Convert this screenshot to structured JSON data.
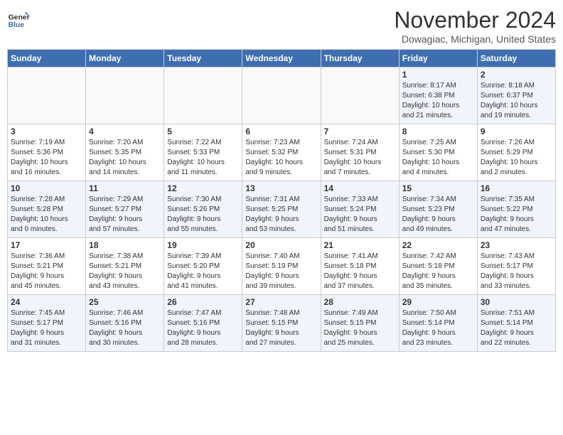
{
  "header": {
    "logo_line1": "General",
    "logo_line2": "Blue",
    "month": "November 2024",
    "location": "Dowagiac, Michigan, United States"
  },
  "weekdays": [
    "Sunday",
    "Monday",
    "Tuesday",
    "Wednesday",
    "Thursday",
    "Friday",
    "Saturday"
  ],
  "weeks": [
    [
      {
        "day": "",
        "info": ""
      },
      {
        "day": "",
        "info": ""
      },
      {
        "day": "",
        "info": ""
      },
      {
        "day": "",
        "info": ""
      },
      {
        "day": "",
        "info": ""
      },
      {
        "day": "1",
        "info": "Sunrise: 8:17 AM\nSunset: 6:38 PM\nDaylight: 10 hours\nand 21 minutes."
      },
      {
        "day": "2",
        "info": "Sunrise: 8:18 AM\nSunset: 6:37 PM\nDaylight: 10 hours\nand 19 minutes."
      }
    ],
    [
      {
        "day": "3",
        "info": "Sunrise: 7:19 AM\nSunset: 5:36 PM\nDaylight: 10 hours\nand 16 minutes."
      },
      {
        "day": "4",
        "info": "Sunrise: 7:20 AM\nSunset: 5:35 PM\nDaylight: 10 hours\nand 14 minutes."
      },
      {
        "day": "5",
        "info": "Sunrise: 7:22 AM\nSunset: 5:33 PM\nDaylight: 10 hours\nand 11 minutes."
      },
      {
        "day": "6",
        "info": "Sunrise: 7:23 AM\nSunset: 5:32 PM\nDaylight: 10 hours\nand 9 minutes."
      },
      {
        "day": "7",
        "info": "Sunrise: 7:24 AM\nSunset: 5:31 PM\nDaylight: 10 hours\nand 7 minutes."
      },
      {
        "day": "8",
        "info": "Sunrise: 7:25 AM\nSunset: 5:30 PM\nDaylight: 10 hours\nand 4 minutes."
      },
      {
        "day": "9",
        "info": "Sunrise: 7:26 AM\nSunset: 5:29 PM\nDaylight: 10 hours\nand 2 minutes."
      }
    ],
    [
      {
        "day": "10",
        "info": "Sunrise: 7:28 AM\nSunset: 5:28 PM\nDaylight: 10 hours\nand 0 minutes."
      },
      {
        "day": "11",
        "info": "Sunrise: 7:29 AM\nSunset: 5:27 PM\nDaylight: 9 hours\nand 57 minutes."
      },
      {
        "day": "12",
        "info": "Sunrise: 7:30 AM\nSunset: 5:26 PM\nDaylight: 9 hours\nand 55 minutes."
      },
      {
        "day": "13",
        "info": "Sunrise: 7:31 AM\nSunset: 5:25 PM\nDaylight: 9 hours\nand 53 minutes."
      },
      {
        "day": "14",
        "info": "Sunrise: 7:33 AM\nSunset: 5:24 PM\nDaylight: 9 hours\nand 51 minutes."
      },
      {
        "day": "15",
        "info": "Sunrise: 7:34 AM\nSunset: 5:23 PM\nDaylight: 9 hours\nand 49 minutes."
      },
      {
        "day": "16",
        "info": "Sunrise: 7:35 AM\nSunset: 5:22 PM\nDaylight: 9 hours\nand 47 minutes."
      }
    ],
    [
      {
        "day": "17",
        "info": "Sunrise: 7:36 AM\nSunset: 5:21 PM\nDaylight: 9 hours\nand 45 minutes."
      },
      {
        "day": "18",
        "info": "Sunrise: 7:38 AM\nSunset: 5:21 PM\nDaylight: 9 hours\nand 43 minutes."
      },
      {
        "day": "19",
        "info": "Sunrise: 7:39 AM\nSunset: 5:20 PM\nDaylight: 9 hours\nand 41 minutes."
      },
      {
        "day": "20",
        "info": "Sunrise: 7:40 AM\nSunset: 5:19 PM\nDaylight: 9 hours\nand 39 minutes."
      },
      {
        "day": "21",
        "info": "Sunrise: 7:41 AM\nSunset: 5:18 PM\nDaylight: 9 hours\nand 37 minutes."
      },
      {
        "day": "22",
        "info": "Sunrise: 7:42 AM\nSunset: 5:18 PM\nDaylight: 9 hours\nand 35 minutes."
      },
      {
        "day": "23",
        "info": "Sunrise: 7:43 AM\nSunset: 5:17 PM\nDaylight: 9 hours\nand 33 minutes."
      }
    ],
    [
      {
        "day": "24",
        "info": "Sunrise: 7:45 AM\nSunset: 5:17 PM\nDaylight: 9 hours\nand 31 minutes."
      },
      {
        "day": "25",
        "info": "Sunrise: 7:46 AM\nSunset: 5:16 PM\nDaylight: 9 hours\nand 30 minutes."
      },
      {
        "day": "26",
        "info": "Sunrise: 7:47 AM\nSunset: 5:16 PM\nDaylight: 9 hours\nand 28 minutes."
      },
      {
        "day": "27",
        "info": "Sunrise: 7:48 AM\nSunset: 5:15 PM\nDaylight: 9 hours\nand 27 minutes."
      },
      {
        "day": "28",
        "info": "Sunrise: 7:49 AM\nSunset: 5:15 PM\nDaylight: 9 hours\nand 25 minutes."
      },
      {
        "day": "29",
        "info": "Sunrise: 7:50 AM\nSunset: 5:14 PM\nDaylight: 9 hours\nand 23 minutes."
      },
      {
        "day": "30",
        "info": "Sunrise: 7:51 AM\nSunset: 5:14 PM\nDaylight: 9 hours\nand 22 minutes."
      }
    ]
  ]
}
